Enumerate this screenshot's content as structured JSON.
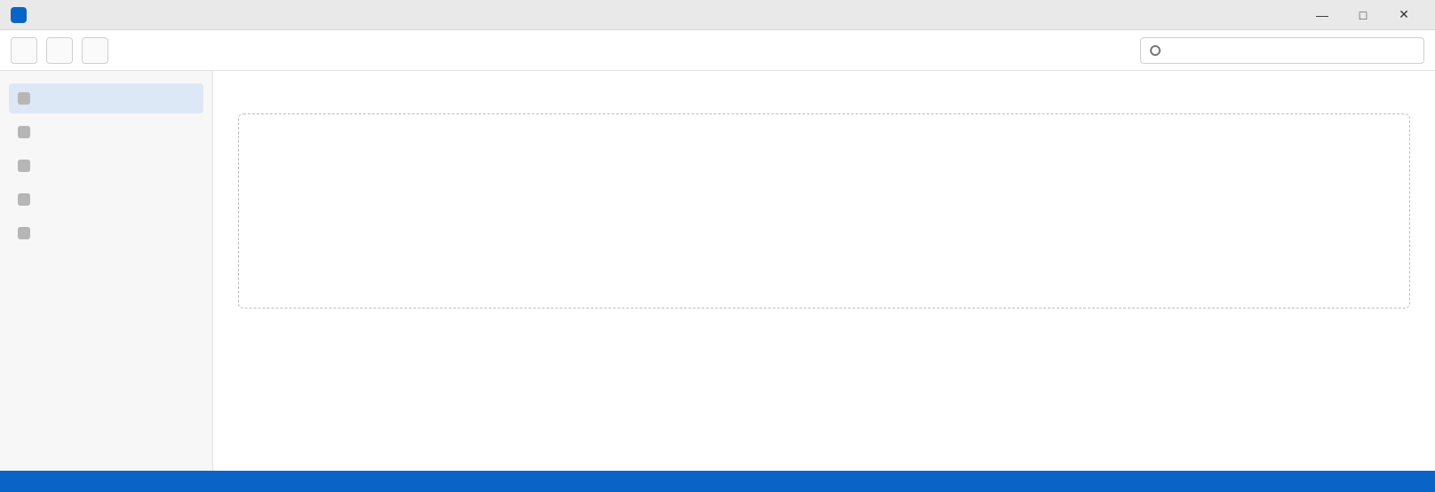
{
  "window": {
    "title": ""
  },
  "toolbar": {
    "buttons": [
      "",
      "",
      ""
    ],
    "search_placeholder": ""
  },
  "sidebar": {
    "items": [
      "",
      "",
      "",
      "",
      ""
    ]
  },
  "main": {
    "heading": "",
    "text": "",
    "placeholder": ""
  },
  "status": {
    "text": ""
  },
  "colors": {
    "accent": "#0a64c8"
  }
}
